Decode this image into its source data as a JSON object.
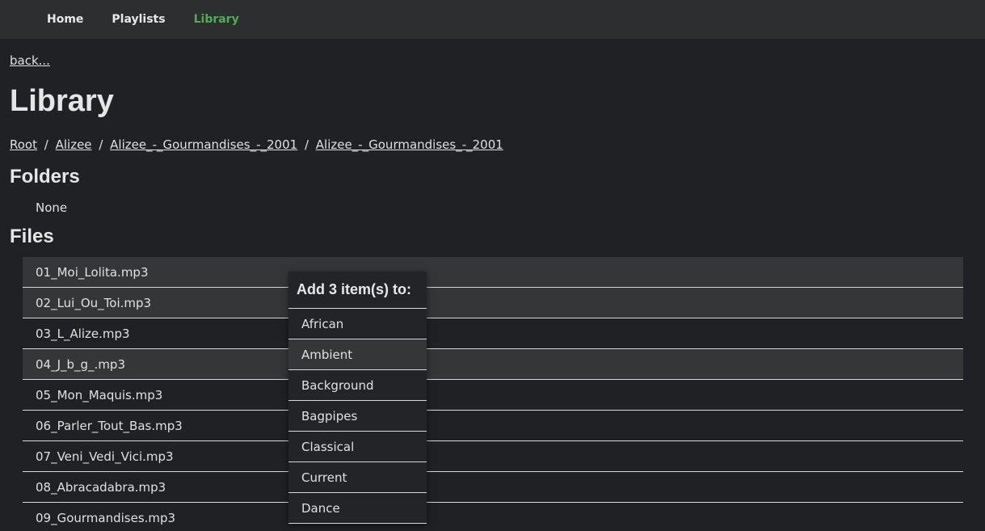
{
  "nav": {
    "home": "Home",
    "playlists": "Playlists",
    "library": "Library",
    "active_color": "#4caf50"
  },
  "back_label": "back...",
  "title": "Library",
  "breadcrumb": [
    "Root",
    "Alizee",
    "Alizee_-_Gourmandises_-_2001",
    "Alizee_-_Gourmandises_-_2001"
  ],
  "breadcrumb_separator": "/",
  "folders": {
    "heading": "Folders",
    "empty_text": "None"
  },
  "files": {
    "heading": "Files",
    "items": [
      {
        "name": "01_Moi_Lolita.mp3",
        "selected": true
      },
      {
        "name": "02_Lui_Ou_Toi.mp3",
        "selected": true
      },
      {
        "name": "03_L_Alize.mp3",
        "selected": false
      },
      {
        "name": "04_J_b_g_.mp3",
        "selected": true
      },
      {
        "name": "05_Mon_Maquis.mp3",
        "selected": false
      },
      {
        "name": "06_Parler_Tout_Bas.mp3",
        "selected": false
      },
      {
        "name": "07_Veni_Vedi_Vici.mp3",
        "selected": false
      },
      {
        "name": "08_Abracadabra.mp3",
        "selected": false
      },
      {
        "name": "09_Gourmandises.mp3",
        "selected": false
      }
    ]
  },
  "add_menu": {
    "header": "Add 3 item(s) to:",
    "items": [
      "African",
      "Ambient",
      "Background",
      "Bagpipes",
      "Classical",
      "Current",
      "Dance"
    ],
    "hovered": "Ambient"
  }
}
